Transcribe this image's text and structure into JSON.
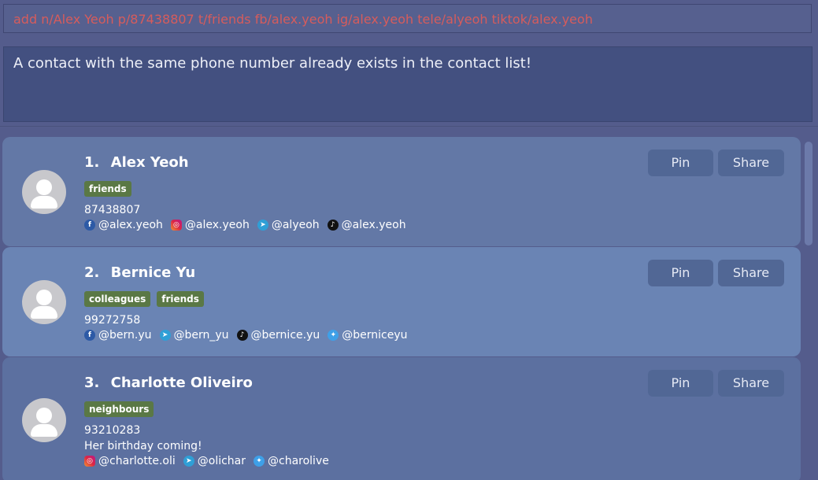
{
  "command": {
    "value": "add n/Alex Yeoh p/87438807 t/friends fb/alex.yeoh ig/alex.yeoh tele/alyeoh tiktok/alex.yeoh"
  },
  "result": {
    "text": "A contact with the same phone number already exists in the contact list!"
  },
  "buttons": {
    "pin": "Pin",
    "share": "Share"
  },
  "contacts": [
    {
      "index": "1.",
      "name": "Alex Yeoh",
      "tags": [
        "friends"
      ],
      "phone": "87438807",
      "socials": [
        {
          "icon": "facebook-icon",
          "handle": "@alex.yeoh"
        },
        {
          "icon": "instagram-icon",
          "handle": "@alex.yeoh"
        },
        {
          "icon": "telegram-icon",
          "handle": "@alyeoh"
        },
        {
          "icon": "tiktok-icon",
          "handle": "@alex.yeoh"
        }
      ]
    },
    {
      "index": "2.",
      "name": "Bernice Yu",
      "tags": [
        "colleagues",
        "friends"
      ],
      "phone": "99272758",
      "socials": [
        {
          "icon": "facebook-icon",
          "handle": "@bern.yu"
        },
        {
          "icon": "telegram-icon",
          "handle": "@bern_yu"
        },
        {
          "icon": "tiktok-icon",
          "handle": "@bernice.yu"
        },
        {
          "icon": "twitter-icon",
          "handle": "@berniceyu"
        }
      ]
    },
    {
      "index": "3.",
      "name": "Charlotte Oliveiro",
      "tags": [
        "neighbours"
      ],
      "phone": "93210283",
      "remark": "Her birthday coming!",
      "socials": [
        {
          "icon": "instagram-icon",
          "handle": "@charlotte.oli"
        },
        {
          "icon": "telegram-icon",
          "handle": "@olichar"
        },
        {
          "icon": "twitter-icon",
          "handle": "@charolive"
        }
      ]
    }
  ]
}
